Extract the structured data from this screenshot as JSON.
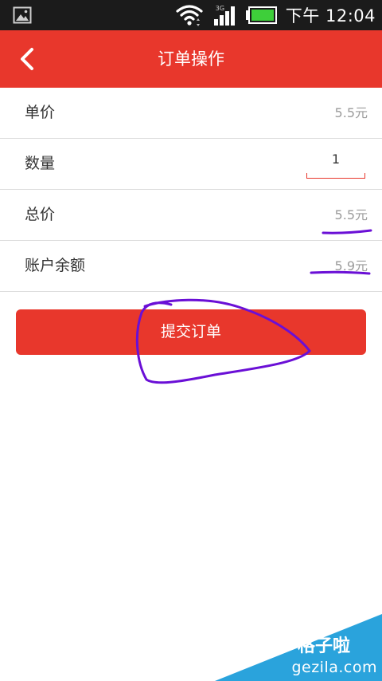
{
  "status_bar": {
    "network_type": "3G",
    "time": "下午 12:04",
    "icons": [
      "image-icon",
      "wifi-icon",
      "signal-icon",
      "battery-icon"
    ]
  },
  "header": {
    "title": "订单操作",
    "back_icon": "back-arrow-icon"
  },
  "order": {
    "rows": [
      {
        "label": "单价",
        "value": "5.5元"
      },
      {
        "label": "数量",
        "value": "1"
      },
      {
        "label": "总价",
        "value": "5.5元"
      },
      {
        "label": "账户余额",
        "value": "5.9元"
      }
    ]
  },
  "actions": {
    "submit_label": "提交订单"
  },
  "watermark": {
    "cn": "格子啦",
    "en": "gezila.com"
  },
  "colors": {
    "status_bar": "#1b1b1b",
    "accent_red": "#e8372c",
    "annotation_purple": "#6a0fd6",
    "watermark_blue": "#2aa3dc",
    "battery_green": "#3ecf3a"
  }
}
